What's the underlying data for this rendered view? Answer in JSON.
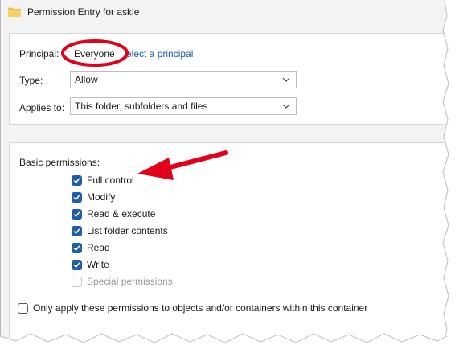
{
  "window": {
    "title": "Permission Entry for askle",
    "icon": "folder-icon"
  },
  "principal": {
    "label": "Principal:",
    "value": "Everyone",
    "select_link": "elect a principal"
  },
  "type": {
    "label": "Type:",
    "value": "Allow"
  },
  "applies_to": {
    "label": "Applies to:",
    "value": "This folder, subfolders and files"
  },
  "basic_permissions": {
    "heading": "Basic permissions:",
    "items": [
      {
        "label": "Full control",
        "checked": true,
        "enabled": true
      },
      {
        "label": "Modify",
        "checked": true,
        "enabled": true
      },
      {
        "label": "Read & execute",
        "checked": true,
        "enabled": true
      },
      {
        "label": "List folder contents",
        "checked": true,
        "enabled": true
      },
      {
        "label": "Read",
        "checked": true,
        "enabled": true
      },
      {
        "label": "Write",
        "checked": true,
        "enabled": true
      },
      {
        "label": "Special permissions",
        "checked": false,
        "enabled": false
      }
    ]
  },
  "apply_only": {
    "label": "Only apply these permissions to objects and/or containers within this container",
    "checked": false
  },
  "colors": {
    "accent": "#1f5fa8",
    "annotation": "#e3001b",
    "link": "#1a5fb4"
  }
}
